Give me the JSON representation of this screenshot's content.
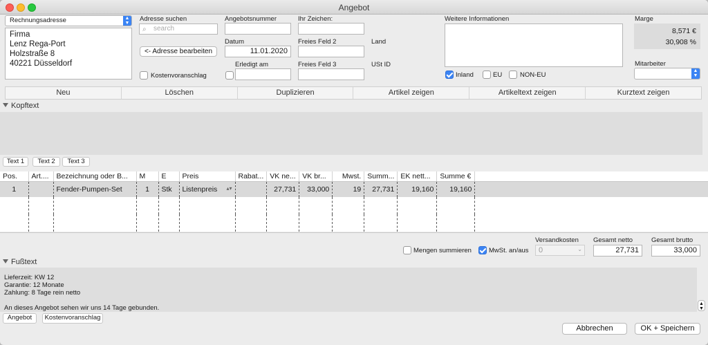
{
  "window": {
    "title": "Angebot"
  },
  "address": {
    "type_select": "Rechnungsadresse",
    "lines": [
      "Firma",
      "Lenz Rega-Port",
      "Holzstraße 8",
      "40221 Düsseldorf"
    ]
  },
  "search": {
    "label": "Adresse suchen",
    "placeholder": "search",
    "edit_button": "<- Adresse bearbeiten",
    "quote_checkbox": "Kostenvoranschlag"
  },
  "offer": {
    "number_label": "Angebotsnummer",
    "number": "",
    "date_label": "Datum",
    "date": "11.01.2020",
    "done_label": "Erledigt am",
    "done": ""
  },
  "refs": {
    "sign_label": "Ihr Zeichen:",
    "sign": "",
    "free2_label": "Freies Feld 2",
    "free2": "",
    "free3_label": "Freies Feld 3",
    "free3": "",
    "country_label": "Land",
    "vat_label": "USt ID"
  },
  "info": {
    "label": "Weitere Informationen",
    "inland": "Inland",
    "eu": "EU",
    "non_eu": "NON-EU"
  },
  "margin": {
    "label": "Marge",
    "amount": "8,571 €",
    "percent": "30,908 %",
    "staff_label": "Mitarbeiter",
    "staff": ""
  },
  "toolbar": [
    "Neu",
    "Löschen",
    "Duplizieren",
    "Artikel zeigen",
    "Artikeltext zeigen",
    "Kurztext zeigen"
  ],
  "header_text": {
    "label": "Kopftext",
    "tabs": [
      "Text 1",
      "Text 2",
      "Text 3"
    ]
  },
  "table": {
    "columns": [
      "Pos.",
      "Art....",
      "Bezeichnung oder B...",
      "M",
      "E",
      "Preis",
      "Rabat...",
      "VK ne...",
      "VK br...",
      "Mwst.",
      "Summ...",
      "EK nett...",
      "Summe €"
    ],
    "rows": [
      [
        "1",
        "",
        "Fender-Pumpen-Set",
        "1",
        "Stk",
        "Listenpreis",
        "",
        "27,731",
        "33,000",
        "19",
        "27,731",
        "19,160",
        "19,160"
      ]
    ]
  },
  "totals": {
    "sum_qty": "Mengen summieren",
    "vat_toggle": "MwSt. an/aus",
    "shipping_label": "Versandkosten",
    "shipping": "0",
    "net_label": "Gesamt netto",
    "net": "27,731",
    "gross_label": "Gesamt brutto",
    "gross": "33,000"
  },
  "footer_text": {
    "label": "Fußtext",
    "lines": [
      "Lieferzeit: KW 12",
      "Garantie: 12 Monate",
      "Zahlung: 8 Tage rein netto",
      "",
      "An dieses Angebot sehen wir uns 14 Tage gebunden."
    ],
    "tabs": [
      "Angebot",
      "Kostenvoranschlag"
    ]
  },
  "actions": {
    "cancel": "Abbrechen",
    "save": "OK + Speichern"
  }
}
